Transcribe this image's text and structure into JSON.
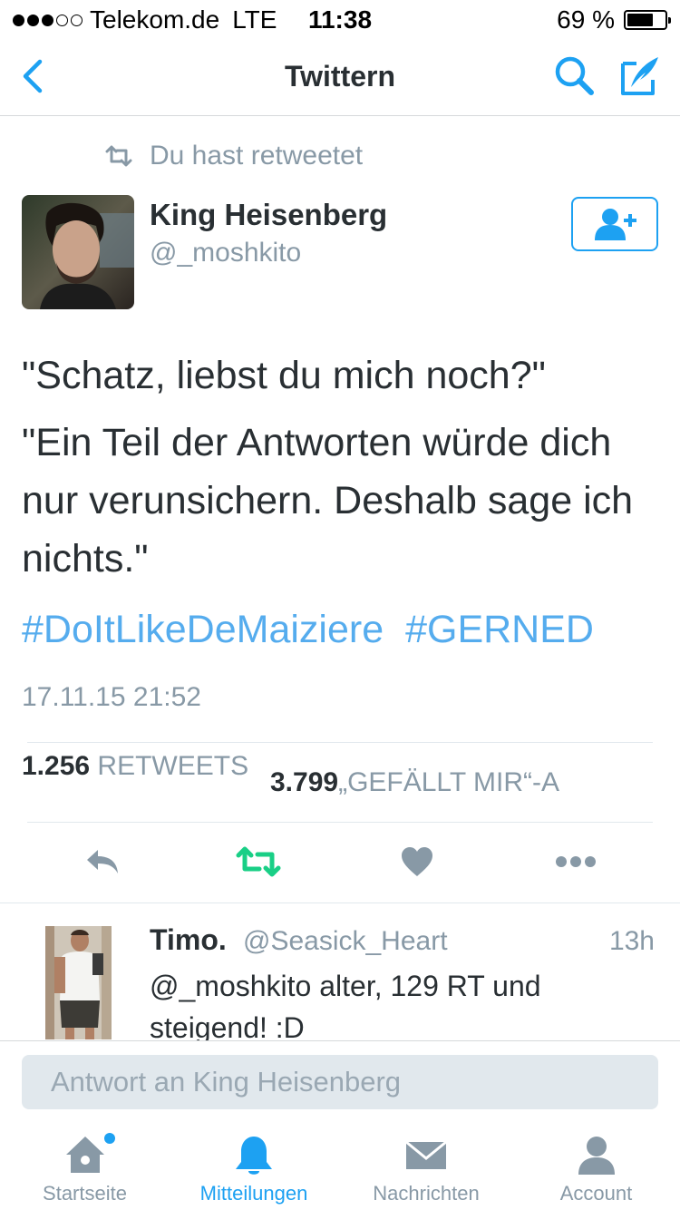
{
  "status_bar": {
    "carrier": "Telekom.de",
    "network": "LTE",
    "time": "11:38",
    "battery": "69 %",
    "battery_level": 0.69,
    "signal_bars_filled": 3,
    "signal_bars_total": 5
  },
  "nav": {
    "title": "Twittern",
    "back_icon": "chevron-left-icon",
    "search_icon": "search-icon",
    "compose_icon": "compose-quill-icon"
  },
  "tweet": {
    "retweet_context": "Du hast retweetet",
    "author_name": "King Heisenberg",
    "author_handle": "@_moshkito",
    "text_lines": [
      "\"Schatz, liebst du mich noch?\"",
      "\"Ein Teil der Antworten würde dich nur verunsichern. Deshalb sage ich nichts.\""
    ],
    "hashtags": [
      "#DoItLikeDeMaiziere",
      "#GERNED"
    ],
    "timestamp": "17.11.15 21:52",
    "retweets_count": "1.256",
    "retweets_label": "RETWEETS",
    "likes_count": "3.799",
    "likes_label": "„GEFÄLLT MIR“-A"
  },
  "actions": [
    "reply-icon",
    "retweet-icon",
    "heart-icon",
    "more-icon"
  ],
  "reply": {
    "name": "Timo.",
    "handle": "@Seasick_Heart",
    "time": "13h",
    "text": "@_moshkito alter, 129 RT und steigend! :D"
  },
  "compose_reply": {
    "placeholder": "Antwort an King Heisenberg"
  },
  "tabs": [
    {
      "label": "Startseite",
      "icon": "home-icon",
      "active": false
    },
    {
      "label": "Mitteilungen",
      "icon": "bell-icon",
      "active": true
    },
    {
      "label": "Nachrichten",
      "icon": "envelope-icon",
      "active": false
    },
    {
      "label": "Account",
      "icon": "person-icon",
      "active": false
    }
  ],
  "colors": {
    "accent": "#1da1f2",
    "hashtag": "#55acee",
    "muted": "#8899a6",
    "retweet_green": "#19cf86",
    "text": "#292f33"
  }
}
